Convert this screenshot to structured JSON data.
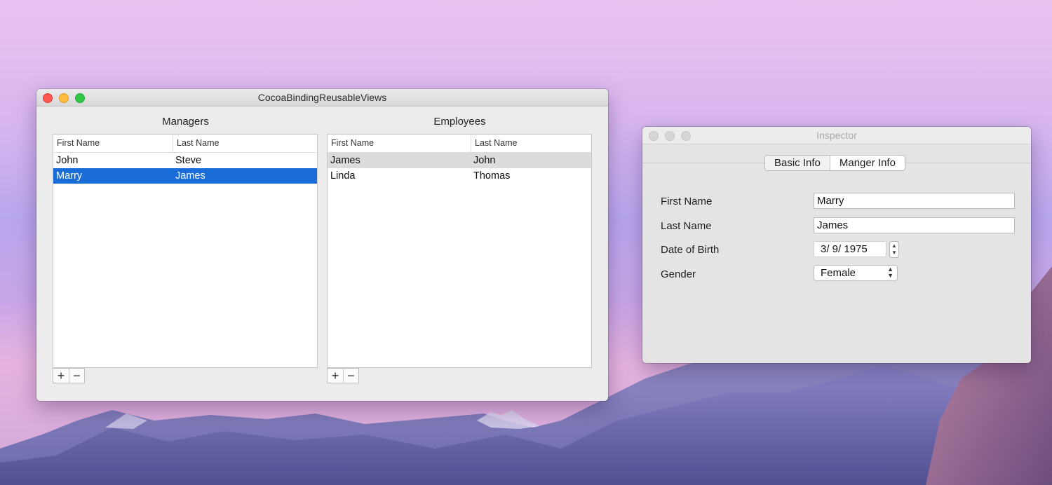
{
  "main_window": {
    "title": "CocoaBindingReusableViews",
    "managers": {
      "title": "Managers",
      "columns": [
        "First Name",
        "Last Name"
      ],
      "rows": [
        {
          "first": "John",
          "last": "Steve"
        },
        {
          "first": "Marry",
          "last": "James"
        }
      ],
      "add_label": "+",
      "remove_label": "−"
    },
    "employees": {
      "title": "Employees",
      "columns": [
        "First Name",
        "Last Name"
      ],
      "rows": [
        {
          "first": "James",
          "last": "John"
        },
        {
          "first": "Linda",
          "last": "Thomas"
        }
      ],
      "add_label": "+",
      "remove_label": "−"
    }
  },
  "inspector": {
    "title": "Inspector",
    "tabs": [
      "Basic Info",
      "Manger Info"
    ],
    "fields": {
      "first_name_label": "First Name",
      "first_name_value": "Marry",
      "last_name_label": "Last Name",
      "last_name_value": "James",
      "dob_label": "Date of Birth",
      "dob_value": "3/  9/ 1975",
      "gender_label": "Gender",
      "gender_value": "Female"
    }
  },
  "colors": {
    "selection": "#1a6cd9",
    "close": "#fc5753",
    "minimize": "#fdbc40",
    "zoom": "#33c748"
  }
}
